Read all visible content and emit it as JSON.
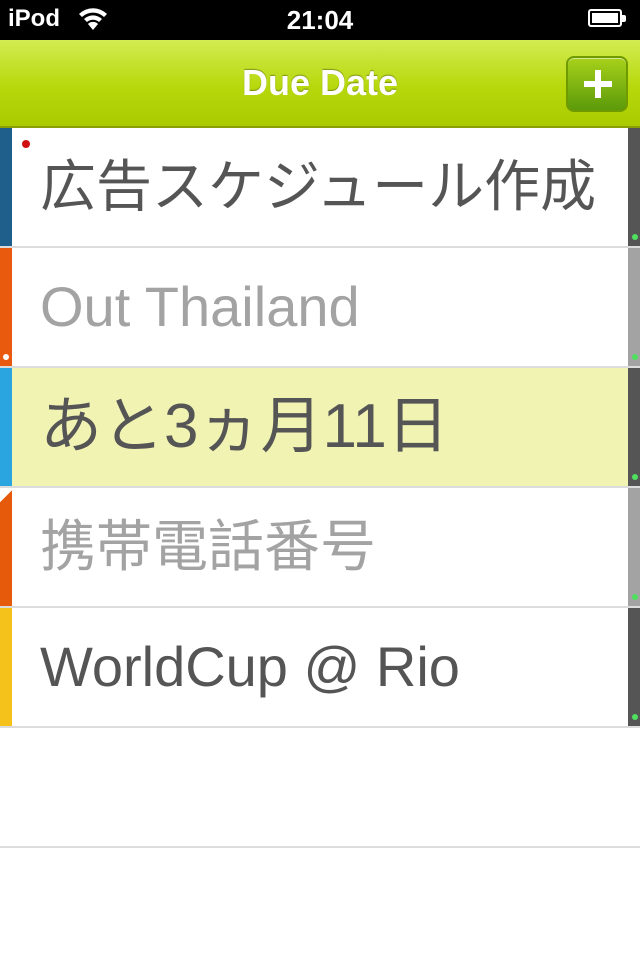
{
  "status_bar": {
    "carrier": "iPod",
    "time": "21:04",
    "icons": [
      "wifi-icon",
      "battery-icon"
    ]
  },
  "nav": {
    "title": "Due Date",
    "add_button_icon": "plus-icon"
  },
  "colors": {
    "nav_bar": "#b7d80b",
    "highlight_row": "#f1f3b3",
    "active_text": "#555555",
    "dimmed_text": "#a3a3a3"
  },
  "items": [
    {
      "label": "広告スケジュール作成",
      "stripe_color": "#1e5f8c",
      "right_bar_color": "#555555",
      "dimmed": false,
      "highlighted": false
    },
    {
      "label": "Out Thailand",
      "stripe_color": "#ea5a0e",
      "right_bar_color": "#a3a3a3",
      "dimmed": true,
      "highlighted": false
    },
    {
      "label": "あと3ヵ月11日",
      "stripe_color": "#2aa5e0",
      "right_bar_color": "#555555",
      "dimmed": false,
      "highlighted": true
    },
    {
      "label": "携帯電話番号",
      "stripe_color": "#e65a0c",
      "right_bar_color": "#a3a3a3",
      "dimmed": true,
      "highlighted": false
    },
    {
      "label": "WorldCup @ Rio",
      "stripe_color": "#f5c21c",
      "right_bar_color": "#555555",
      "dimmed": false,
      "highlighted": false
    }
  ]
}
